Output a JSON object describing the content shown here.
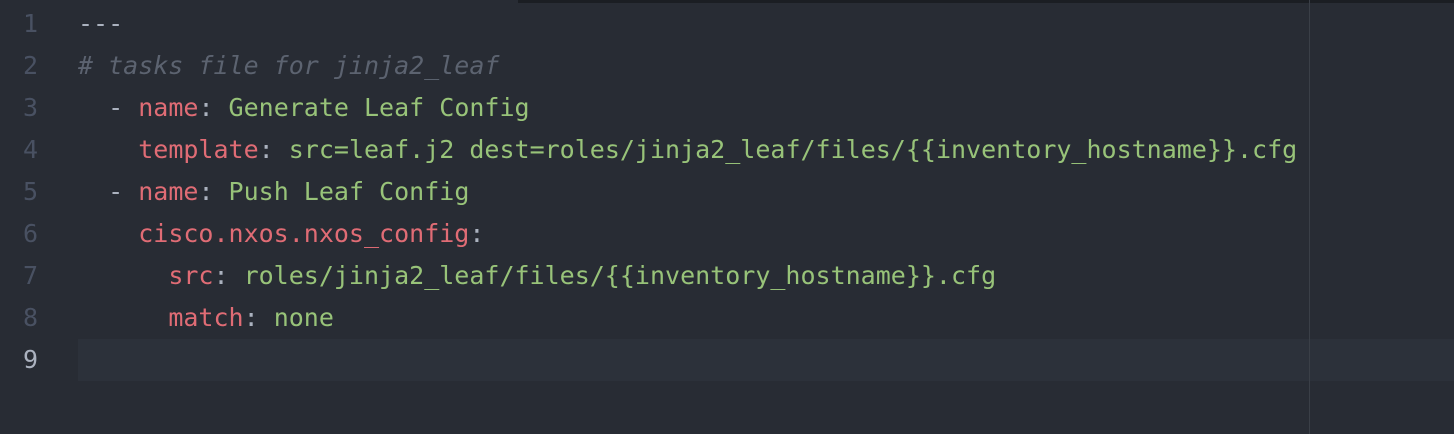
{
  "editor": {
    "active_line": 9,
    "colors": {
      "background": "#282c34",
      "key": "#e06c75",
      "string": "#98c379",
      "comment": "#5c6370",
      "plain": "#abb2bf",
      "gutter": "#495162"
    },
    "lines": [
      {
        "num": "1",
        "tokens": [
          {
            "type": "plain",
            "text": "---"
          }
        ]
      },
      {
        "num": "2",
        "tokens": [
          {
            "type": "comment",
            "text": "# tasks file for jinja2_leaf"
          }
        ]
      },
      {
        "num": "3",
        "tokens": [
          {
            "type": "plain",
            "text": "  - "
          },
          {
            "type": "key",
            "text": "name"
          },
          {
            "type": "plain",
            "text": ": "
          },
          {
            "type": "str",
            "text": "Generate Leaf Config"
          }
        ]
      },
      {
        "num": "4",
        "tokens": [
          {
            "type": "plain",
            "text": "    "
          },
          {
            "type": "key",
            "text": "template"
          },
          {
            "type": "plain",
            "text": ": "
          },
          {
            "type": "str",
            "text": "src=leaf.j2 dest=roles/jinja2_leaf/files/{{inventory_hostname}}.cfg"
          }
        ]
      },
      {
        "num": "5",
        "tokens": [
          {
            "type": "plain",
            "text": "  - "
          },
          {
            "type": "key",
            "text": "name"
          },
          {
            "type": "plain",
            "text": ": "
          },
          {
            "type": "str",
            "text": "Push Leaf Config"
          }
        ]
      },
      {
        "num": "6",
        "tokens": [
          {
            "type": "plain",
            "text": "    "
          },
          {
            "type": "key",
            "text": "cisco.nxos.nxos_config"
          },
          {
            "type": "plain",
            "text": ":"
          }
        ]
      },
      {
        "num": "7",
        "tokens": [
          {
            "type": "plain",
            "text": "      "
          },
          {
            "type": "key",
            "text": "src"
          },
          {
            "type": "plain",
            "text": ": "
          },
          {
            "type": "str",
            "text": "roles/jinja2_leaf/files/{{inventory_hostname}}.cfg"
          }
        ]
      },
      {
        "num": "8",
        "tokens": [
          {
            "type": "plain",
            "text": "      "
          },
          {
            "type": "key",
            "text": "match"
          },
          {
            "type": "plain",
            "text": ": "
          },
          {
            "type": "str",
            "text": "none"
          }
        ]
      },
      {
        "num": "9",
        "tokens": []
      }
    ]
  }
}
